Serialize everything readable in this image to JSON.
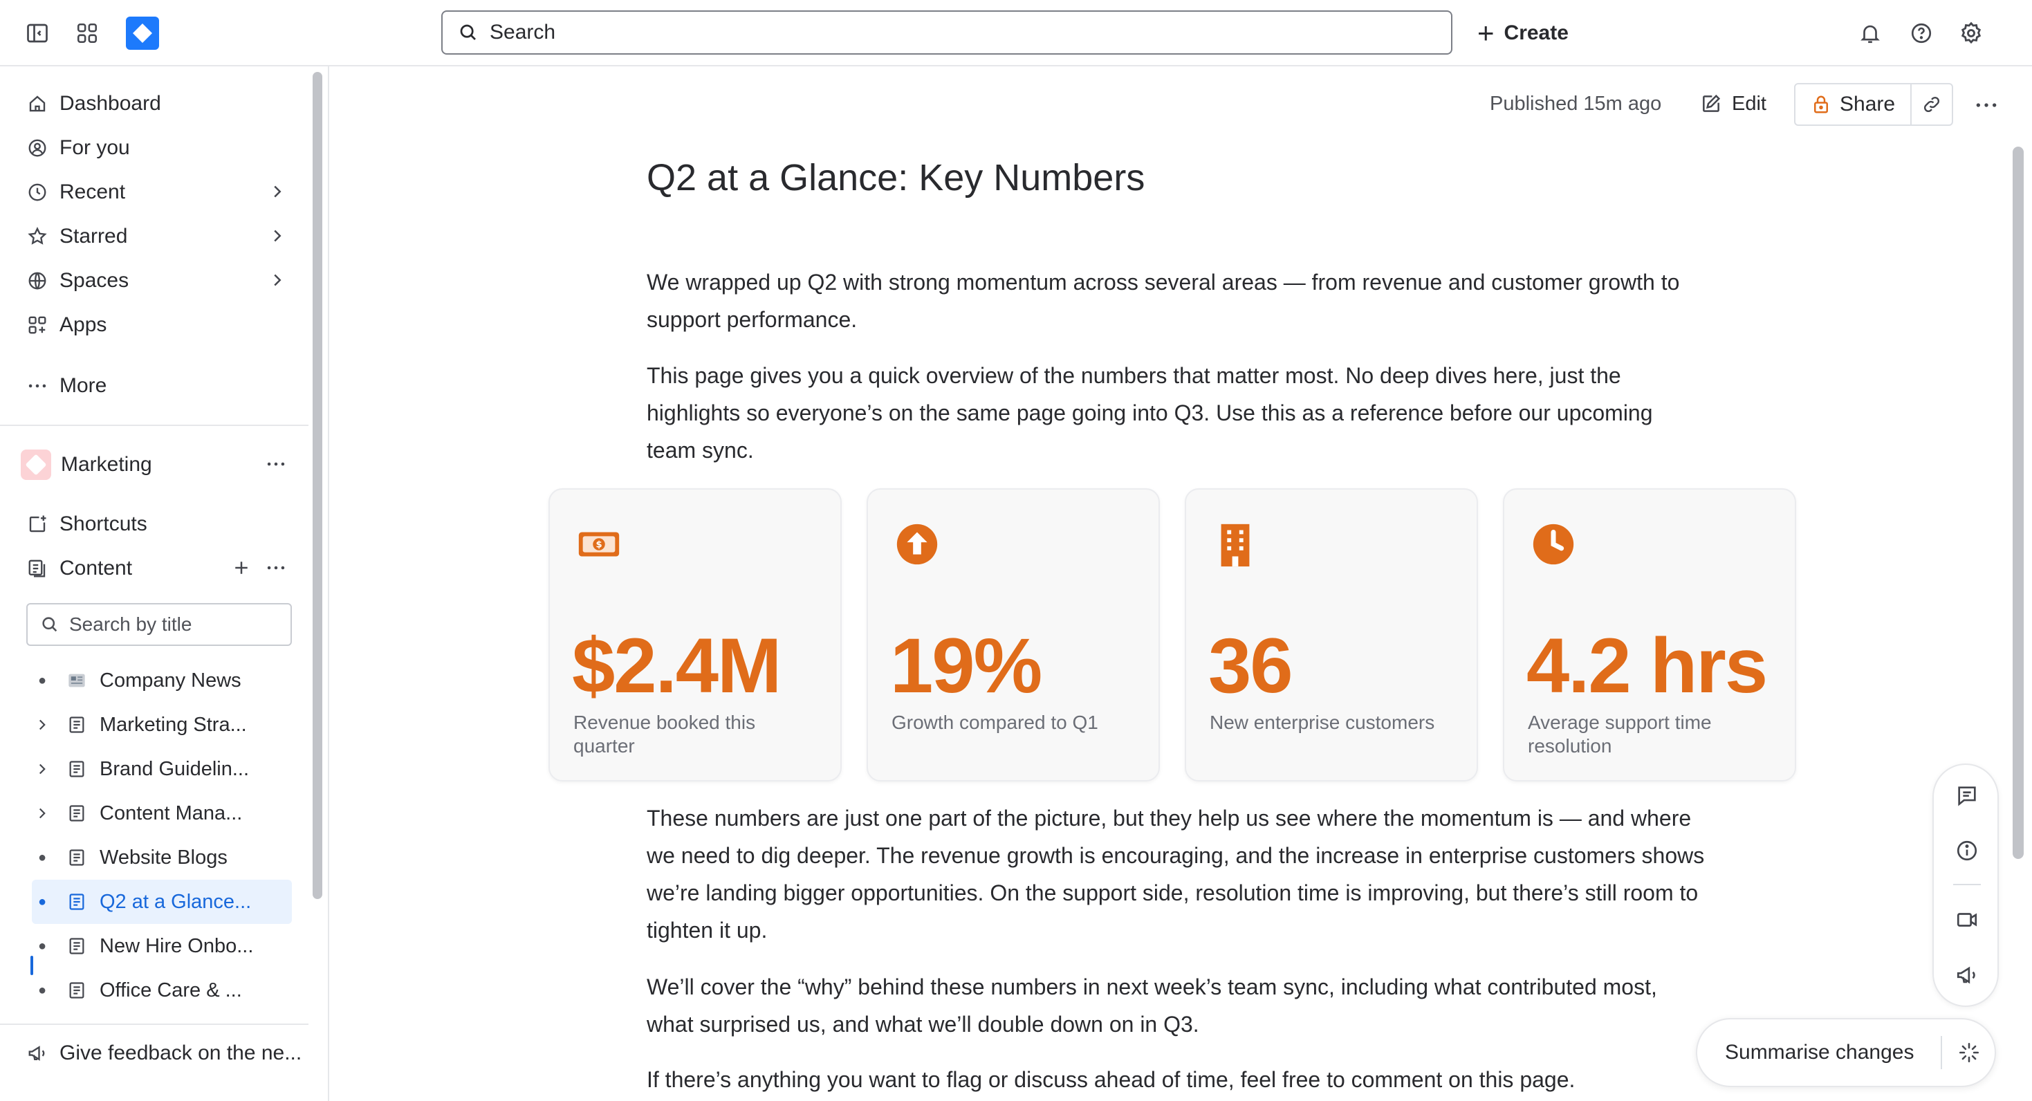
{
  "topbar": {
    "search_placeholder": "Search",
    "create_label": "Create"
  },
  "sidebar": {
    "nav": [
      {
        "label": "Dashboard"
      },
      {
        "label": "For you"
      },
      {
        "label": "Recent"
      },
      {
        "label": "Starred"
      },
      {
        "label": "Spaces"
      },
      {
        "label": "Apps"
      },
      {
        "label": "More"
      }
    ],
    "space_name": "Marketing",
    "shortcuts_label": "Shortcuts",
    "content_label": "Content",
    "search_placeholder": "Search by title",
    "tree": [
      {
        "label": "Company News"
      },
      {
        "label": "Marketing Stra..."
      },
      {
        "label": "Brand Guidelin..."
      },
      {
        "label": "Content Mana..."
      },
      {
        "label": "Website Blogs"
      },
      {
        "label": "Q2 at a Glance..."
      },
      {
        "label": "New Hire Onbo..."
      },
      {
        "label": "Office Care & ..."
      }
    ],
    "feedback_label": "Give feedback on the ne..."
  },
  "page": {
    "published": "Published 15m ago",
    "edit_label": "Edit",
    "share_label": "Share",
    "title": "Q2 at a Glance: Key Numbers",
    "intro1": "We wrapped up Q2 with strong momentum across several areas — from revenue and customer growth to support performance.",
    "intro2": "This page gives you a quick overview of the numbers that matter most. No deep dives here, just the highlights so everyone’s on the same page going into Q3. Use this as a reference before our upcoming team sync.",
    "stats": [
      {
        "value": "$2.4M",
        "label": "Revenue booked this quarter",
        "icon": "money-icon"
      },
      {
        "value": "19%",
        "label": "Growth compared to Q1",
        "icon": "arrow-up-circle-icon"
      },
      {
        "value": "36",
        "label": "New enterprise customers",
        "icon": "building-icon"
      },
      {
        "value": "4.2 hrs",
        "label": "Average support time resolution",
        "icon": "clock-icon"
      }
    ],
    "body1": "These numbers are just one part of the picture, but they help us see where the momentum is — and where we need to dig deeper. The revenue growth is encouraging, and the increase in enterprise customers shows we’re landing bigger opportunities. On the support side, resolution time is improving, but there’s still room to tighten it up.",
    "body2": "We’ll cover the “why” behind these numbers in next week’s team sync, including what contributed most, what surprised us, and what we’ll double down on in Q3.",
    "body3": "If there’s anything you want to flag or discuss ahead of time, feel free to comment on this page.",
    "summarise_label": "Summarise changes"
  },
  "colors": {
    "accent_orange": "#e06c1a",
    "brand_blue": "#1868db"
  }
}
